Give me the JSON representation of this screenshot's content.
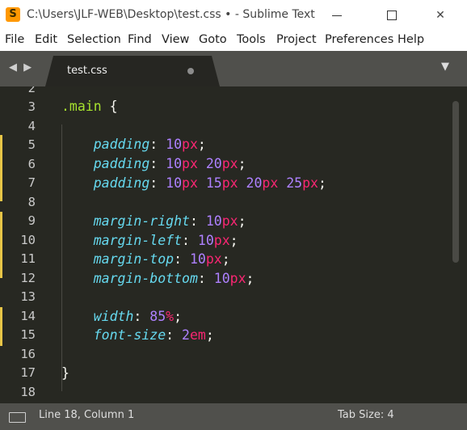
{
  "window": {
    "title": "C:\\Users\\JLF-WEB\\Desktop\\test.css • - Sublime Text",
    "minimize_glyph": "",
    "maximize_glyph": "",
    "close_glyph": "✕"
  },
  "menu": {
    "items": [
      "File",
      "Edit",
      "Selection",
      "Find",
      "View",
      "Goto",
      "Tools",
      "Project",
      "Preferences",
      "Help"
    ]
  },
  "tabs": {
    "nav_arrows": "◀ ▶",
    "active_tab": "test.css",
    "dropdown_glyph": "▼"
  },
  "editor": {
    "line_numbers": [
      "2",
      "3",
      "4",
      "5",
      "6",
      "7",
      "8",
      "9",
      "10",
      "11",
      "12",
      "13",
      "14",
      "15",
      "16",
      "17",
      "18"
    ],
    "code": {
      "l3_selector": ".main",
      "l3_brace": " {",
      "l5_prop": "padding",
      "l5_v1": "10",
      "l5_u1": "px",
      "l6_prop": "padding",
      "l6_v1": "10",
      "l6_u1": "px",
      "l6_v2": "20",
      "l6_u2": "px",
      "l7_prop": "padding",
      "l7_v1": "10",
      "l7_u1": "px",
      "l7_v2": "15",
      "l7_u2": "px",
      "l7_v3": "20",
      "l7_u3": "px",
      "l7_v4": "25",
      "l7_u4": "px",
      "l9_prop": "margin-right",
      "l9_v1": "10",
      "l9_u1": "px",
      "l10_prop": "margin-left",
      "l10_v1": "10",
      "l10_u1": "px",
      "l11_prop": "margin-top",
      "l11_v1": "10",
      "l11_u1": "px",
      "l12_prop": "margin-bottom",
      "l12_v1": "10",
      "l12_u1": "px",
      "l14_prop": "width",
      "l14_v1": "85",
      "l14_u1": "%",
      "l15_prop": "font-size",
      "l15_v1": "2",
      "l15_u1": "em",
      "l17_brace": "}"
    },
    "colors": {
      "background": "#272822",
      "selector": "#a6e22e",
      "property": "#66d9ef",
      "number": "#ae81ff",
      "unit": "#f92672",
      "modified_marker": "#e7c547"
    }
  },
  "status": {
    "position": "Line 18, Column 1",
    "tab_size": "Tab Size: 4"
  }
}
